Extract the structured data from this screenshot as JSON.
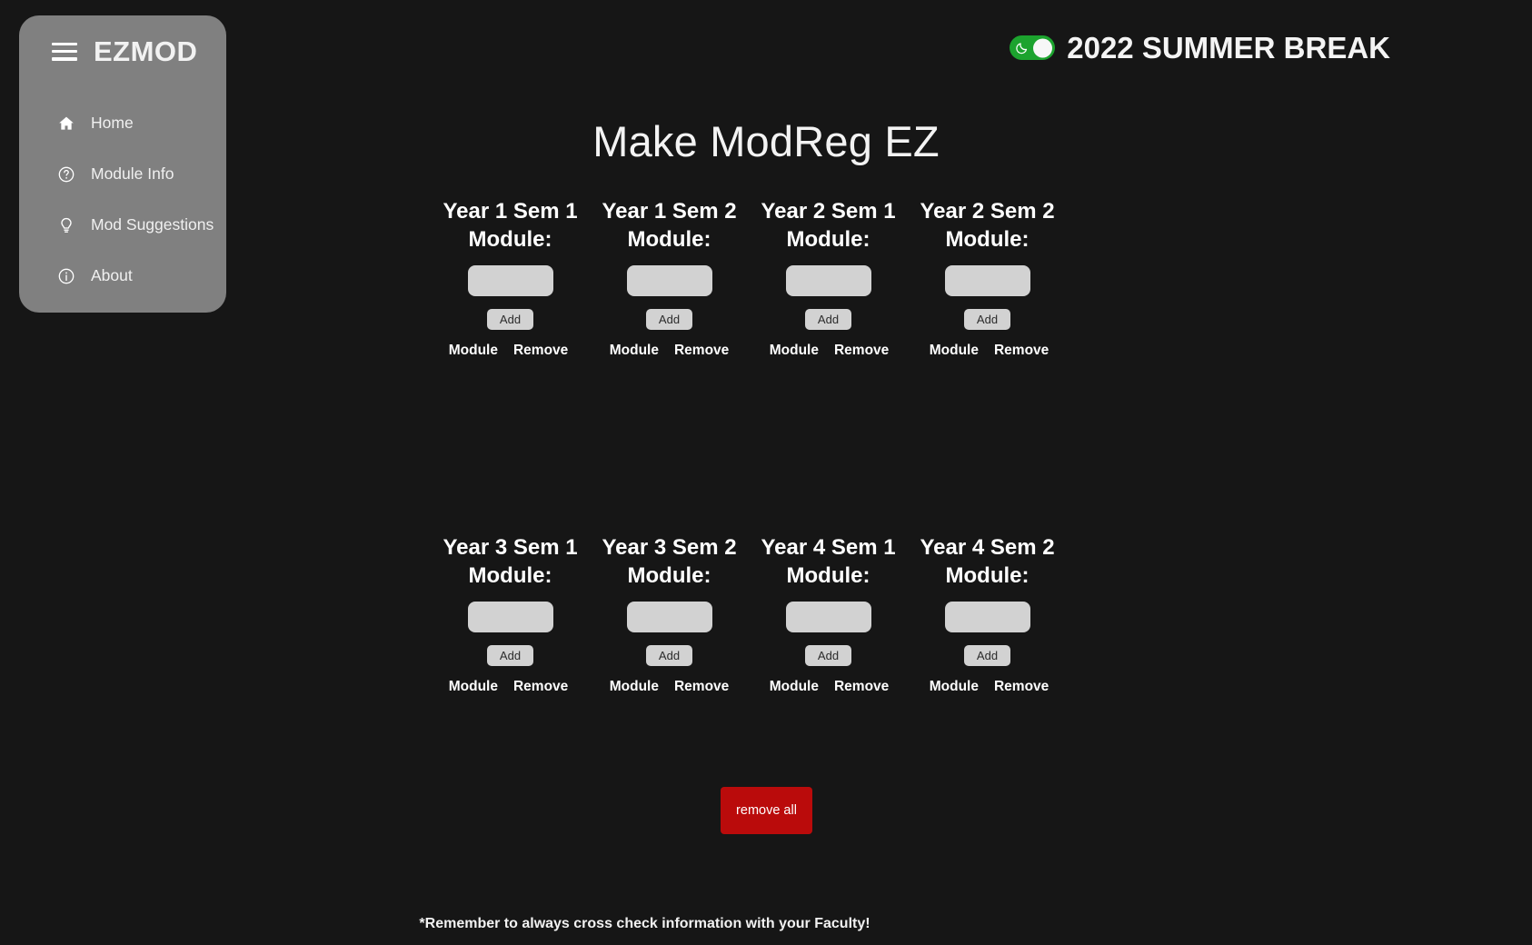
{
  "sidebar": {
    "menu_icon": "hamburger-icon",
    "brand": "EZMOD",
    "items": [
      {
        "label": "Home",
        "icon": "home-icon"
      },
      {
        "label": "Module Info",
        "icon": "question-circle-icon"
      },
      {
        "label": "Mod Suggestions",
        "icon": "lightbulb-icon"
      },
      {
        "label": "About",
        "icon": "info-circle-icon"
      }
    ]
  },
  "header": {
    "toggle": {
      "icon": "moon-icon",
      "state": "on",
      "color": "#1ca32e"
    },
    "season_label": "2022 SUMMER BREAK"
  },
  "main": {
    "title": "Make ModReg EZ",
    "input_placeholder": "",
    "input_value": "",
    "add_label": "Add",
    "col_module": "Module",
    "col_remove": "Remove",
    "semesters": [
      {
        "title_line1": "Year 1 Sem 1",
        "title_line2": "Module:"
      },
      {
        "title_line1": "Year 1 Sem 2",
        "title_line2": "Module:"
      },
      {
        "title_line1": "Year 2 Sem 1",
        "title_line2": "Module:"
      },
      {
        "title_line1": "Year 2 Sem 2",
        "title_line2": "Module:"
      },
      {
        "title_line1": "Year 3 Sem 1",
        "title_line2": "Module:"
      },
      {
        "title_line1": "Year 3 Sem 2",
        "title_line2": "Module:"
      },
      {
        "title_line1": "Year 4 Sem 1",
        "title_line2": "Module:"
      },
      {
        "title_line1": "Year 4 Sem 2",
        "title_line2": "Module:"
      }
    ],
    "remove_all_label": "remove all"
  },
  "footer": {
    "note": "*Remember to always cross check information with your Faculty!"
  },
  "colors": {
    "background": "#161616",
    "sidebar": "#808080",
    "accent_danger": "#ba0b0b",
    "toggle_on": "#1ca32e",
    "field": "#d2d2d2"
  }
}
